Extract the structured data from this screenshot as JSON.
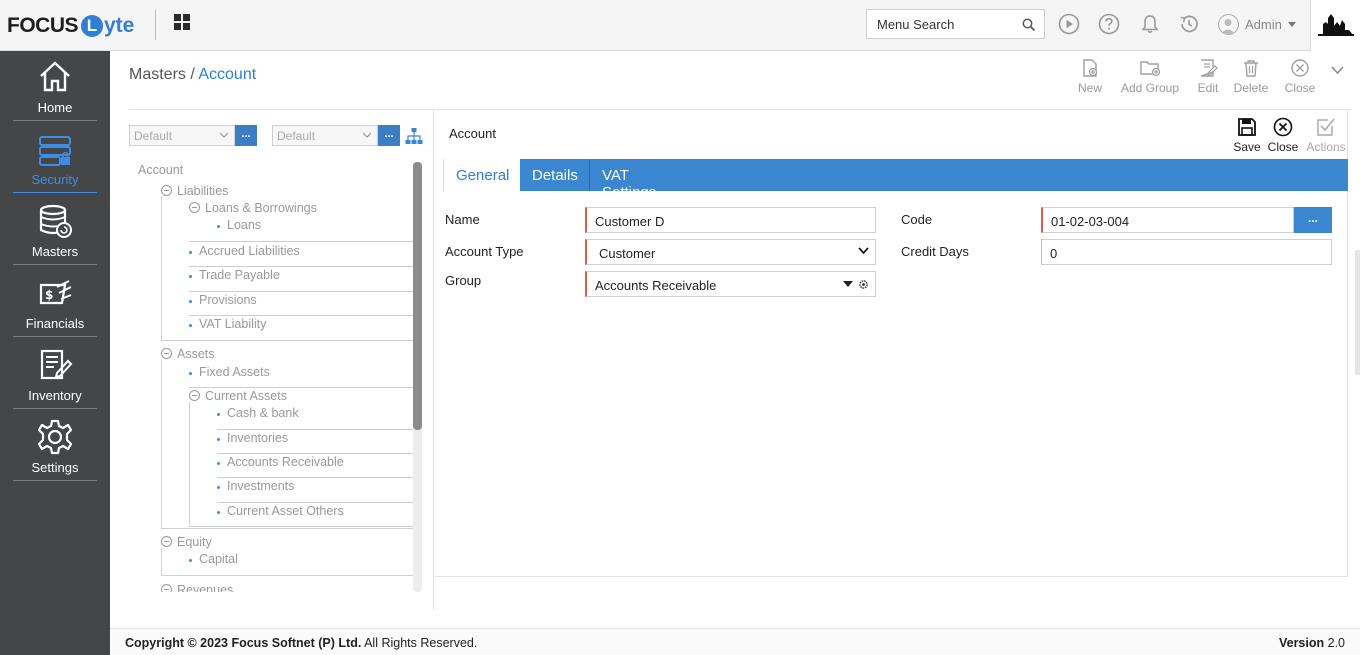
{
  "app": {
    "logo_part1": "FOCUS",
    "logo_letter": "L",
    "logo_part2": "yte",
    "menu_search_placeholder": "Menu Search",
    "user": "Admin"
  },
  "sidebar": {
    "items": [
      {
        "label": "Home",
        "icon": "home-icon"
      },
      {
        "label": "Security",
        "icon": "security-icon",
        "active": true
      },
      {
        "label": "Masters",
        "icon": "masters-icon"
      },
      {
        "label": "Financials",
        "icon": "financials-icon"
      },
      {
        "label": "Inventory",
        "icon": "inventory-icon"
      },
      {
        "label": "Settings",
        "icon": "settings-icon"
      }
    ]
  },
  "breadcrumb": {
    "parent": "Masters / ",
    "current": "Account"
  },
  "toolbar": {
    "new": "New",
    "add_group": "Add Group",
    "edit": "Edit",
    "delete": "Delete",
    "close": "Close"
  },
  "tree_panel": {
    "select1": "Default",
    "select2": "Default",
    "dots": "...",
    "root": "Account",
    "nodes": {
      "liabilities": "Liabilities",
      "loans_borrowings": "Loans & Borrowings",
      "loans": "Loans",
      "accrued": "Accrued Liabilities",
      "trade_payable": "Trade Payable",
      "provisions": "Provisions",
      "vat_liability": "VAT Liability",
      "assets": "Assets",
      "fixed_assets": "Fixed Assets",
      "current_assets": "Current Assets",
      "cash_bank": "Cash & bank",
      "inventories": "Inventories",
      "accounts_receivable": "Accounts Receivable",
      "investments": "Investments",
      "current_asset_others": "Current Asset Others",
      "equity": "Equity",
      "capital": "Capital",
      "revenues": "Revenues"
    }
  },
  "form": {
    "title": "Account",
    "actions": {
      "save": "Save",
      "close": "Close",
      "actions": "Actions"
    },
    "tabs": [
      "General",
      "Details",
      "VAT Settings"
    ],
    "fields": {
      "name_label": "Name",
      "name_value": "Customer D",
      "account_type_label": "Account Type",
      "account_type_value": "Customer",
      "group_label": "Group",
      "group_value": "Accounts Receivable",
      "code_label": "Code",
      "code_value": "01-02-03-004",
      "code_button": "...",
      "credit_days_label": "Credit Days",
      "credit_days_value": "0"
    }
  },
  "footer": {
    "copyright_bold": "Copyright © 2023 Focus Softnet (P) Ltd.",
    "copyright_rest": " All Rights Reserved.",
    "version_label": "Version",
    "version_value": " 2.0"
  },
  "colors": {
    "accent": "#3a86d1",
    "sidebar": "#444648",
    "required": "#e05a4e"
  }
}
